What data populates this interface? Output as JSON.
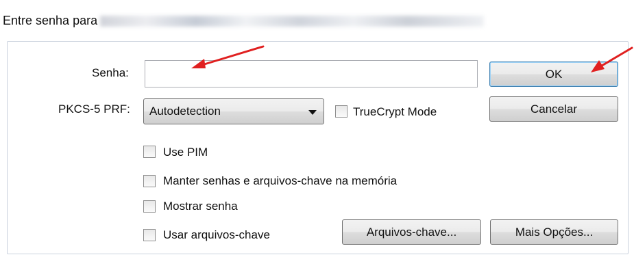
{
  "dialog": {
    "title_prefix": "Entre senha para",
    "title_obscured": true
  },
  "password": {
    "label": "Senha:",
    "value": ""
  },
  "prf": {
    "label": "PKCS-5 PRF:",
    "selected": "Autodetection"
  },
  "options": {
    "truecrypt_mode": {
      "label": "TrueCrypt Mode",
      "checked": false
    },
    "use_pim": {
      "label": "Use PIM",
      "checked": false
    },
    "cache_passwords": {
      "label": "Manter senhas e arquivos-chave na memória",
      "checked": false
    },
    "show_password": {
      "label": "Mostrar senha",
      "checked": false
    },
    "use_keyfiles": {
      "label": "Usar arquivos-chave",
      "checked": false
    }
  },
  "buttons": {
    "ok": "OK",
    "cancel": "Cancelar",
    "keyfiles": "Arquivos-chave...",
    "more_options": "Mais Opções..."
  },
  "annotations": {
    "arrow_color": "#e02020"
  }
}
